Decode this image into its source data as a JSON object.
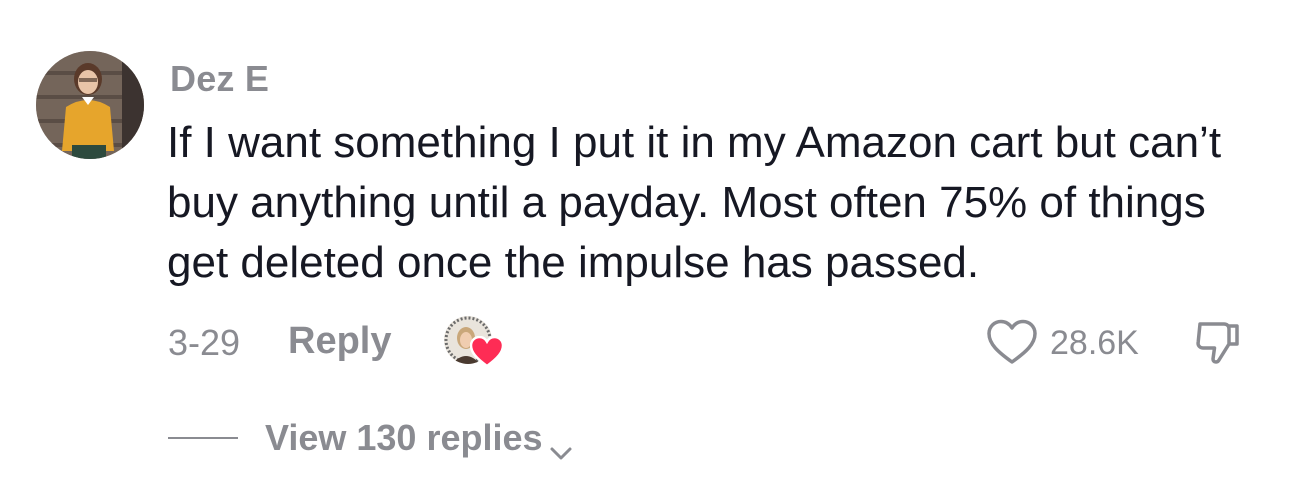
{
  "comment": {
    "username": "Dez E",
    "text": "If I want something I put it in my Amazon cart but can’t buy anything until a payday. Most often 75% of things get deleted once the impulse has passed.",
    "date": "3-29",
    "reply_label": "Reply",
    "like_count": "28.6K",
    "view_replies_label": "View 130 replies"
  },
  "icons": {
    "like": "heart-outline-icon",
    "dislike": "thumbs-down-icon",
    "creator_liked": "heart-badge-icon",
    "expand": "chevron-down-icon"
  },
  "colors": {
    "text": "#161823",
    "muted": "#8a8b91",
    "heart_badge": "#fe2c55"
  }
}
